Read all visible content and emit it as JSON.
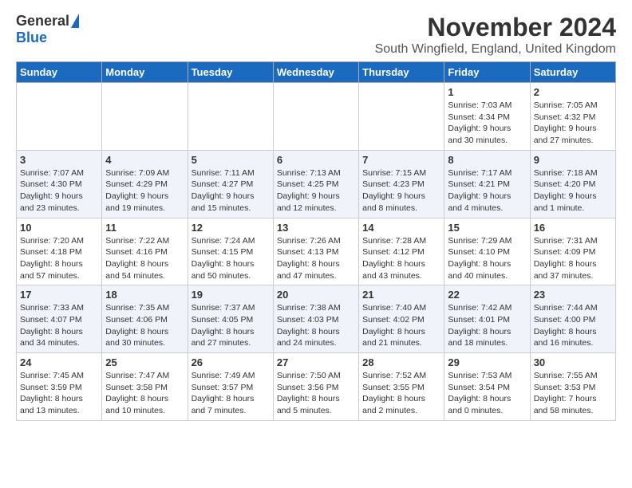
{
  "logo": {
    "general": "General",
    "blue": "Blue"
  },
  "title": "November 2024",
  "subtitle": "South Wingfield, England, United Kingdom",
  "weekdays": [
    "Sunday",
    "Monday",
    "Tuesday",
    "Wednesday",
    "Thursday",
    "Friday",
    "Saturday"
  ],
  "weeks": [
    [
      {
        "day": "",
        "info": ""
      },
      {
        "day": "",
        "info": ""
      },
      {
        "day": "",
        "info": ""
      },
      {
        "day": "",
        "info": ""
      },
      {
        "day": "",
        "info": ""
      },
      {
        "day": "1",
        "info": "Sunrise: 7:03 AM\nSunset: 4:34 PM\nDaylight: 9 hours and 30 minutes."
      },
      {
        "day": "2",
        "info": "Sunrise: 7:05 AM\nSunset: 4:32 PM\nDaylight: 9 hours and 27 minutes."
      }
    ],
    [
      {
        "day": "3",
        "info": "Sunrise: 7:07 AM\nSunset: 4:30 PM\nDaylight: 9 hours and 23 minutes."
      },
      {
        "day": "4",
        "info": "Sunrise: 7:09 AM\nSunset: 4:29 PM\nDaylight: 9 hours and 19 minutes."
      },
      {
        "day": "5",
        "info": "Sunrise: 7:11 AM\nSunset: 4:27 PM\nDaylight: 9 hours and 15 minutes."
      },
      {
        "day": "6",
        "info": "Sunrise: 7:13 AM\nSunset: 4:25 PM\nDaylight: 9 hours and 12 minutes."
      },
      {
        "day": "7",
        "info": "Sunrise: 7:15 AM\nSunset: 4:23 PM\nDaylight: 9 hours and 8 minutes."
      },
      {
        "day": "8",
        "info": "Sunrise: 7:17 AM\nSunset: 4:21 PM\nDaylight: 9 hours and 4 minutes."
      },
      {
        "day": "9",
        "info": "Sunrise: 7:18 AM\nSunset: 4:20 PM\nDaylight: 9 hours and 1 minute."
      }
    ],
    [
      {
        "day": "10",
        "info": "Sunrise: 7:20 AM\nSunset: 4:18 PM\nDaylight: 8 hours and 57 minutes."
      },
      {
        "day": "11",
        "info": "Sunrise: 7:22 AM\nSunset: 4:16 PM\nDaylight: 8 hours and 54 minutes."
      },
      {
        "day": "12",
        "info": "Sunrise: 7:24 AM\nSunset: 4:15 PM\nDaylight: 8 hours and 50 minutes."
      },
      {
        "day": "13",
        "info": "Sunrise: 7:26 AM\nSunset: 4:13 PM\nDaylight: 8 hours and 47 minutes."
      },
      {
        "day": "14",
        "info": "Sunrise: 7:28 AM\nSunset: 4:12 PM\nDaylight: 8 hours and 43 minutes."
      },
      {
        "day": "15",
        "info": "Sunrise: 7:29 AM\nSunset: 4:10 PM\nDaylight: 8 hours and 40 minutes."
      },
      {
        "day": "16",
        "info": "Sunrise: 7:31 AM\nSunset: 4:09 PM\nDaylight: 8 hours and 37 minutes."
      }
    ],
    [
      {
        "day": "17",
        "info": "Sunrise: 7:33 AM\nSunset: 4:07 PM\nDaylight: 8 hours and 34 minutes."
      },
      {
        "day": "18",
        "info": "Sunrise: 7:35 AM\nSunset: 4:06 PM\nDaylight: 8 hours and 30 minutes."
      },
      {
        "day": "19",
        "info": "Sunrise: 7:37 AM\nSunset: 4:05 PM\nDaylight: 8 hours and 27 minutes."
      },
      {
        "day": "20",
        "info": "Sunrise: 7:38 AM\nSunset: 4:03 PM\nDaylight: 8 hours and 24 minutes."
      },
      {
        "day": "21",
        "info": "Sunrise: 7:40 AM\nSunset: 4:02 PM\nDaylight: 8 hours and 21 minutes."
      },
      {
        "day": "22",
        "info": "Sunrise: 7:42 AM\nSunset: 4:01 PM\nDaylight: 8 hours and 18 minutes."
      },
      {
        "day": "23",
        "info": "Sunrise: 7:44 AM\nSunset: 4:00 PM\nDaylight: 8 hours and 16 minutes."
      }
    ],
    [
      {
        "day": "24",
        "info": "Sunrise: 7:45 AM\nSunset: 3:59 PM\nDaylight: 8 hours and 13 minutes."
      },
      {
        "day": "25",
        "info": "Sunrise: 7:47 AM\nSunset: 3:58 PM\nDaylight: 8 hours and 10 minutes."
      },
      {
        "day": "26",
        "info": "Sunrise: 7:49 AM\nSunset: 3:57 PM\nDaylight: 8 hours and 7 minutes."
      },
      {
        "day": "27",
        "info": "Sunrise: 7:50 AM\nSunset: 3:56 PM\nDaylight: 8 hours and 5 minutes."
      },
      {
        "day": "28",
        "info": "Sunrise: 7:52 AM\nSunset: 3:55 PM\nDaylight: 8 hours and 2 minutes."
      },
      {
        "day": "29",
        "info": "Sunrise: 7:53 AM\nSunset: 3:54 PM\nDaylight: 8 hours and 0 minutes."
      },
      {
        "day": "30",
        "info": "Sunrise: 7:55 AM\nSunset: 3:53 PM\nDaylight: 7 hours and 58 minutes."
      }
    ]
  ]
}
